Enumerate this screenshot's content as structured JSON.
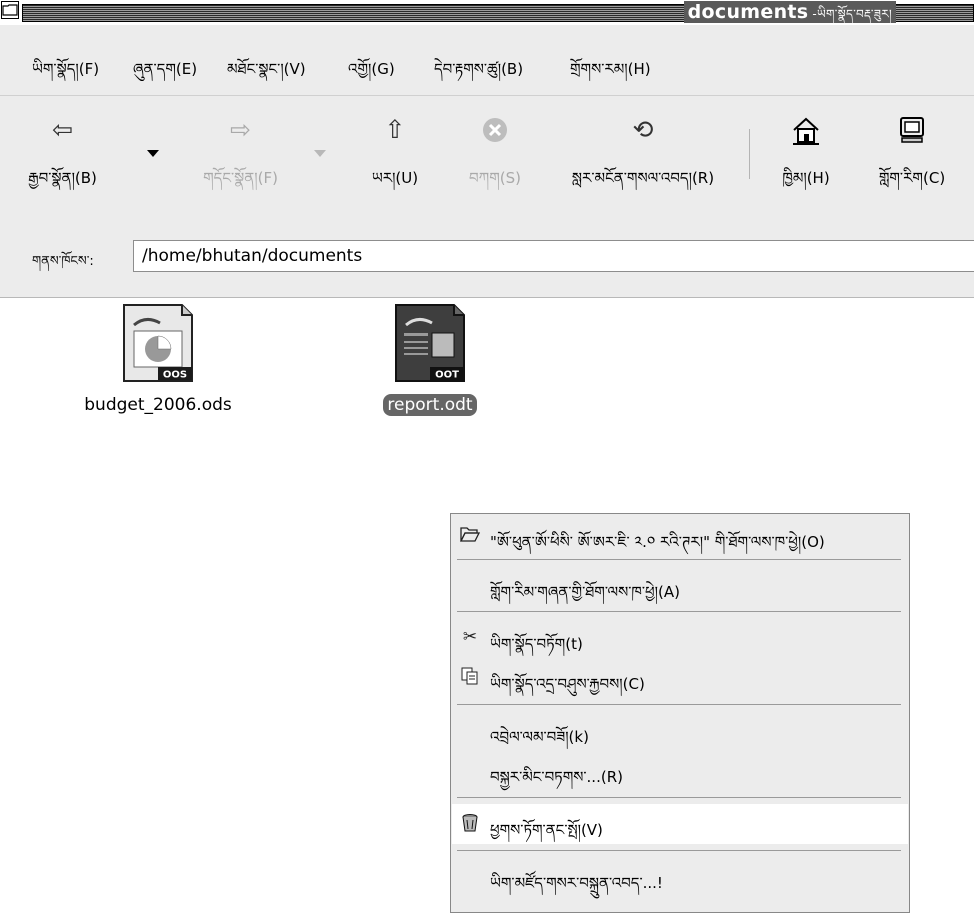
{
  "window": {
    "title": "documents",
    "title_suffix": "-ཡིག་སྣོད་བརྡ་ཟུར།"
  },
  "menubar": {
    "items": [
      {
        "label": "ཡིག་སྣོད།(F)"
      },
      {
        "label": "ཞུན་དག(E)"
      },
      {
        "label": "མཐོང་སྣང་།(V)"
      },
      {
        "label": "འགྱོ།(G)"
      },
      {
        "label": "དེབ་རྟགས་ཚུ།(B)"
      },
      {
        "label": "གྲོགས་རམ།(H)"
      }
    ]
  },
  "toolbar": {
    "back": {
      "label": "རྒྱབ་སྣོན།(B)",
      "icon": "arrow-left-icon"
    },
    "forward": {
      "label": "གདོང་སྣོན།(F)",
      "icon": "arrow-right-icon"
    },
    "up": {
      "label": "ཡར།(U)",
      "icon": "arrow-up-icon"
    },
    "stop": {
      "label": "བཀག(S)",
      "icon": "stop-icon"
    },
    "reload": {
      "label": "སླར་མངོན་གསལ་འབད།(R)",
      "icon": "reload-icon"
    },
    "home": {
      "label": "ཁྱིམ།(H)",
      "icon": "home-icon"
    },
    "computer": {
      "label": "གློག་རིག(C)",
      "icon": "computer-icon"
    }
  },
  "location": {
    "label": "གནས་ཁོངས་:",
    "value": "/home/bhutan/documents"
  },
  "files": [
    {
      "name": "budget_2006.ods",
      "badge": "OOS",
      "selected": false
    },
    {
      "name": "report.odt",
      "badge": "OOT",
      "selected": true
    }
  ],
  "context_menu": {
    "items": [
      {
        "label": "\"ཨོ་ཕུན་ཨོ་ཕིསི་ ཨོ་ཨར་ཇི་ ༢.༠ རའི་ཊར།\" གི་ཐོག་ལས་ཁ་ཕྱེ།(O)",
        "icon": "folder-open-icon"
      },
      {
        "label": "གློག་རིམ་གཞན་གྱི་ཐོག་ལས་ཁ་ཕྱེ།(A)",
        "icon": ""
      },
      {
        "label": "ཡིག་སྣོད་བཏོག(t)",
        "icon": "scissors-icon"
      },
      {
        "label": "ཡིག་སྣོད་འདྲ་བཤུས་རྐྱབས།(C)",
        "icon": "copy-icon"
      },
      {
        "label": "འབྲེལ་ལམ་བཟོ།(k)",
        "icon": ""
      },
      {
        "label": "བསྐྱར་མིང་བཏགས་...(R)",
        "icon": ""
      },
      {
        "label": "ཕྱགས་ཏོག་ནང་སྤོ།(V)",
        "icon": "trash-icon"
      },
      {
        "label": "ཡིག་མཛོད་གསར་བསྐྲུན་འབད་...!",
        "icon": ""
      }
    ]
  }
}
